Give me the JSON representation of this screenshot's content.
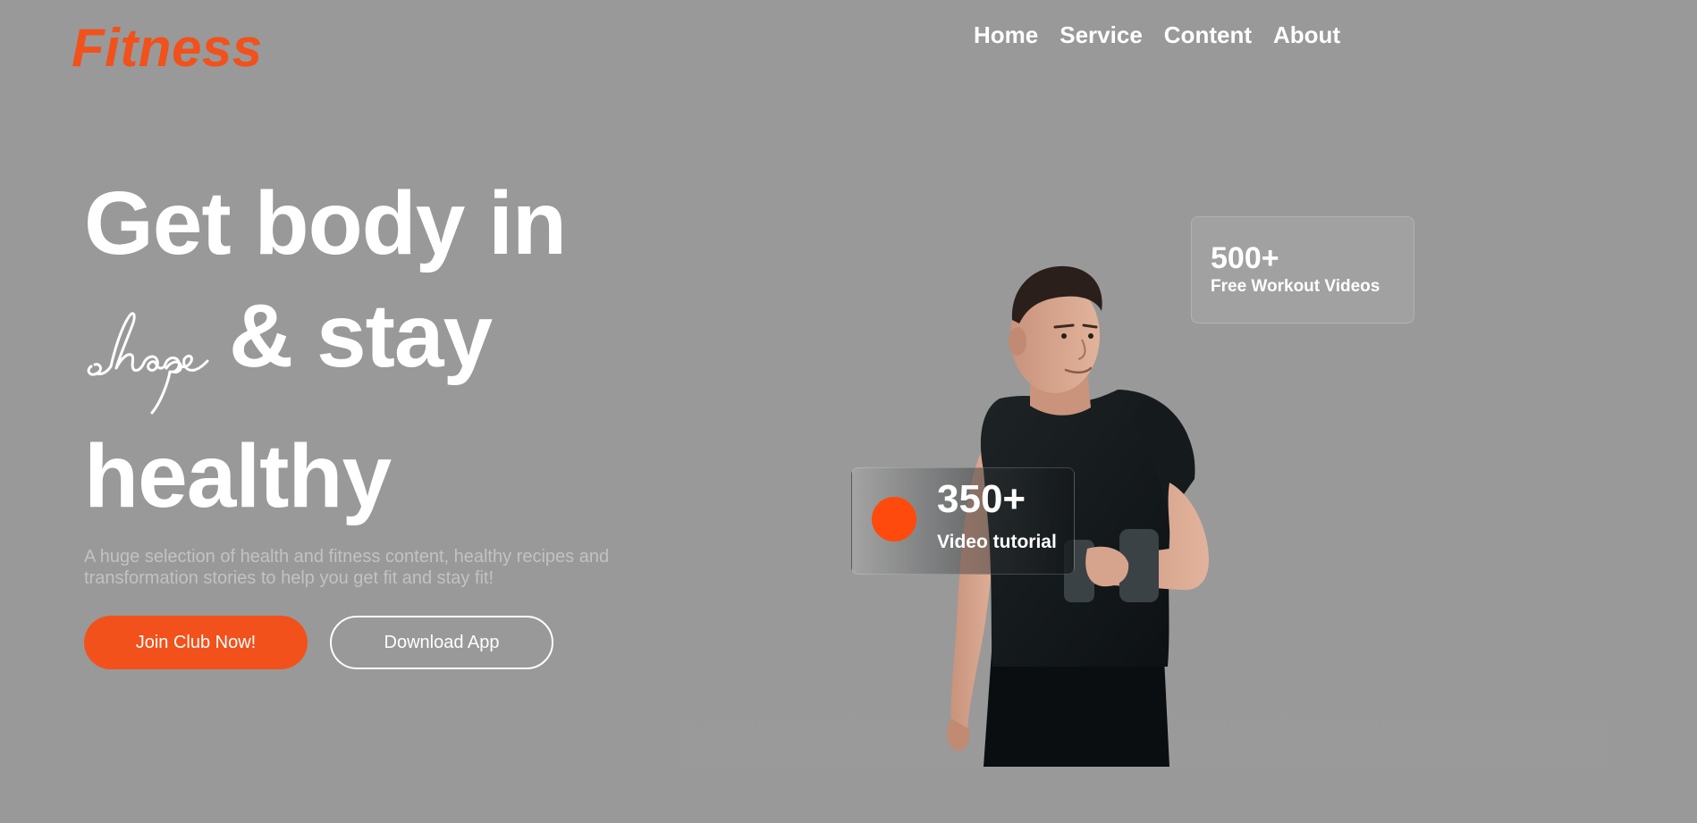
{
  "brand": {
    "logo_text": "Fitness",
    "accent_color": "#f2511b"
  },
  "nav": {
    "items": [
      {
        "label": "Home"
      },
      {
        "label": "Service"
      },
      {
        "label": "Content"
      },
      {
        "label": "About"
      }
    ]
  },
  "hero": {
    "headline_line1": "Get body in",
    "headline_script_word": "shape",
    "headline_line2_rest": "& stay",
    "headline_line3": "healthy",
    "subtext": "A huge selection of health and fitness content, healthy recipes and transformation stories to help you get fit and stay fit!",
    "primary_button_label": "Join Club Now!",
    "secondary_button_label": "Download App"
  },
  "stats": {
    "workout_videos": {
      "count": "500+",
      "label": "Free Workout Videos"
    },
    "video_tutorials": {
      "count": "350+",
      "label": "Video tutorial",
      "dot_color": "#ff4a0d"
    }
  },
  "image": {
    "icon": "athlete-with-dumbbell-photo"
  }
}
